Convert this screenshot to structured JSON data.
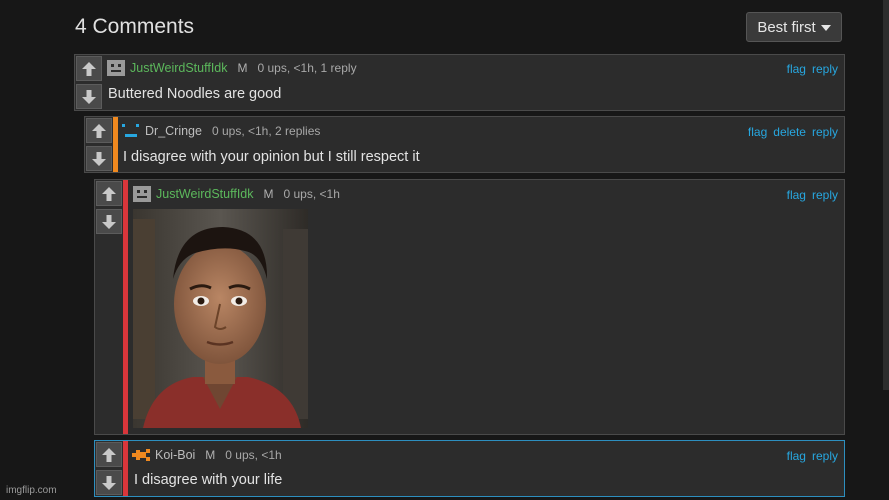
{
  "header": {
    "title": "4 Comments",
    "sort_label": "Best first"
  },
  "comments": [
    {
      "username": "JustWeirdStuffIdk",
      "mod": "M",
      "meta": "0 ups, <1h, 1 reply",
      "text": "Buttered Noodles are good",
      "actions": [
        "flag",
        "reply"
      ],
      "stripe_color": "",
      "name_color": "#5cb85c"
    },
    {
      "username": "Dr_Cringe",
      "mod": "",
      "meta": "0 ups, <1h, 2 replies",
      "text": "I disagree with your opinion but I still respect it",
      "actions": [
        "flag",
        "delete",
        "reply"
      ],
      "stripe_color": "#f0891f",
      "name_color": "#bdbdbd"
    },
    {
      "username": "JustWeirdStuffIdk",
      "mod": "M",
      "meta": "0 ups, <1h",
      "text": "",
      "actions": [
        "flag",
        "reply"
      ],
      "stripe_color": "#d9363b",
      "name_color": "#5cb85c",
      "has_image": true
    },
    {
      "username": "Koi-Boi",
      "mod": "M",
      "meta": "0 ups, <1h",
      "text": "I disagree with your life",
      "actions": [
        "flag",
        "reply"
      ],
      "stripe_color": "#d9363b",
      "name_color": "#bdbdbd"
    }
  ],
  "watermark": "imgflip.com",
  "icons": {
    "upvote": "arrow-up-icon",
    "downvote": "arrow-down-icon",
    "sort": "caret-down-icon"
  },
  "colors": {
    "link": "#27a7e0",
    "username_green": "#5cb85c",
    "orange_stripe": "#f0891f",
    "red_stripe": "#d9363b",
    "highlight_border": "#2d8fbf"
  }
}
